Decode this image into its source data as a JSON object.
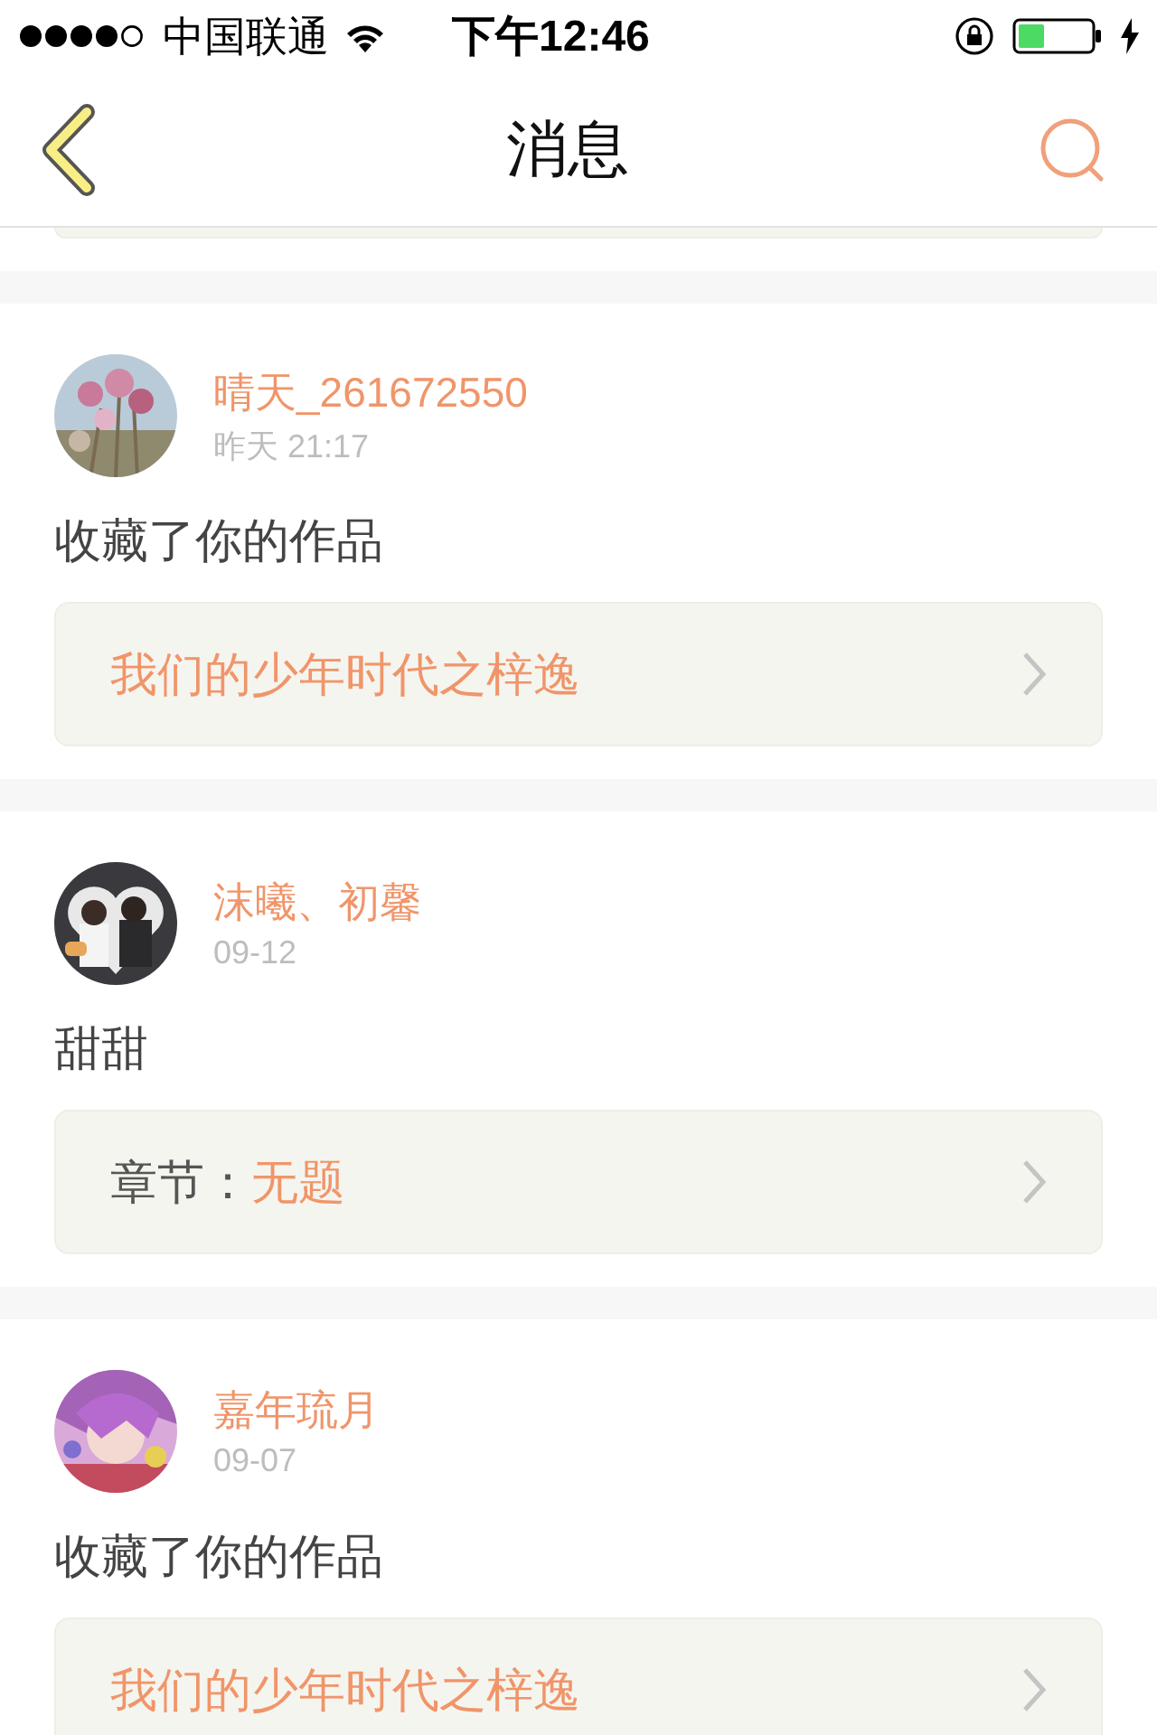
{
  "status_bar": {
    "carrier": "中国联通",
    "time": "下午12:46"
  },
  "nav": {
    "title": "消息"
  },
  "messages": [
    {
      "user": "晴天_261672550",
      "time": "昨天 21:17",
      "text": "收藏了你的作品",
      "link": {
        "kind": "work",
        "title": "我们的少年时代之梓逸"
      }
    },
    {
      "user": "沫曦、初馨",
      "time": "09-12",
      "text": "甜甜",
      "link": {
        "kind": "chapter",
        "label": "章节：",
        "title": "无题"
      }
    },
    {
      "user": "嘉年琉月",
      "time": "09-07",
      "text": "收藏了你的作品",
      "link": {
        "kind": "work",
        "title": "我们的少年时代之梓逸"
      }
    }
  ]
}
